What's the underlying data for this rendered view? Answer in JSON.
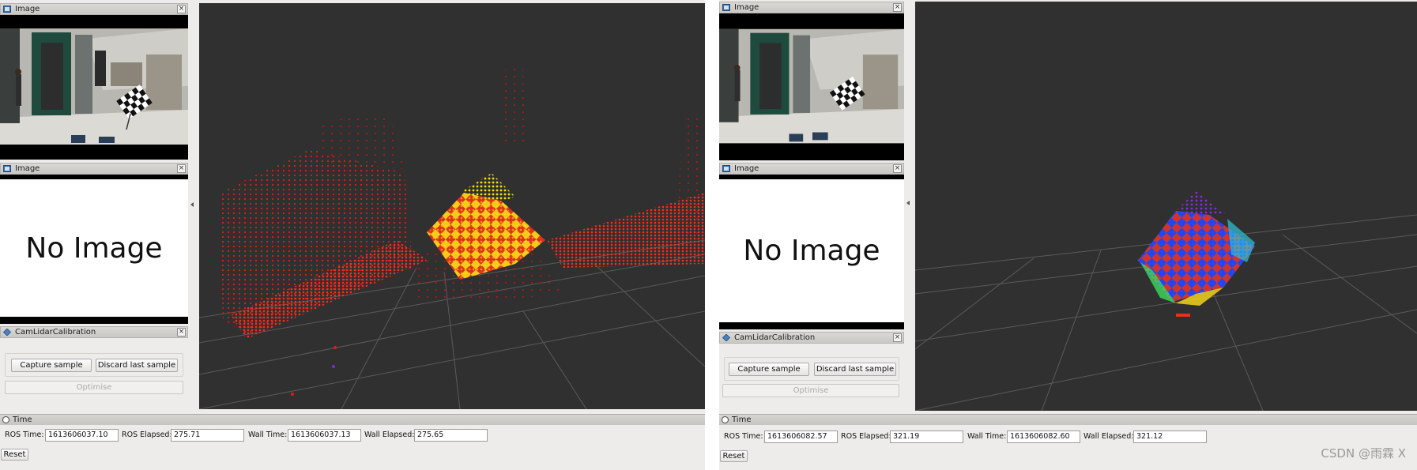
{
  "left": {
    "panels": {
      "image_top": "Image",
      "image_bottom": "Image",
      "calib": "CamLidarCalibration"
    },
    "no_image_text": "No Image",
    "buttons": {
      "capture": "Capture sample",
      "discard": "Discard last sample",
      "optimise": "Optimise"
    },
    "time": {
      "title": "Time",
      "ros_time_label": "ROS Time:",
      "ros_time": "1613606037.10",
      "ros_elapsed_label": "ROS Elapsed:",
      "ros_elapsed": "275.71",
      "wall_time_label": "Wall Time:",
      "wall_time": "1613606037.13",
      "wall_elapsed_label": "Wall Elapsed:",
      "wall_elapsed": "275.65",
      "reset": "Reset"
    }
  },
  "right": {
    "panels": {
      "image_top": "Image",
      "image_bottom": "Image",
      "calib": "CamLidarCalibration"
    },
    "no_image_text": "No Image",
    "buttons": {
      "capture": "Capture sample",
      "discard": "Discard last sample",
      "optimise": "Optimise"
    },
    "time": {
      "title": "Time",
      "ros_time_label": "ROS Time:",
      "ros_time": "1613606082.57",
      "ros_elapsed_label": "ROS Elapsed:",
      "ros_elapsed": "321.19",
      "wall_time_label": "Wall Time:",
      "wall_time": "1613606082.60",
      "wall_elapsed_label": "Wall Elapsed:",
      "wall_elapsed": "321.12",
      "reset": "Reset"
    }
  },
  "watermark": "CSDN @雨霖 X",
  "colors": {
    "viewport_bg": "#303030",
    "grid": "#5a5a5a",
    "lidar_red": "#e81a12",
    "lidar_yellow": "#f2e21a"
  },
  "icons": {
    "panel": "image-window-icon",
    "calib": "diamond-plugin-icon",
    "time": "clock-icon",
    "close": "close-icon"
  }
}
